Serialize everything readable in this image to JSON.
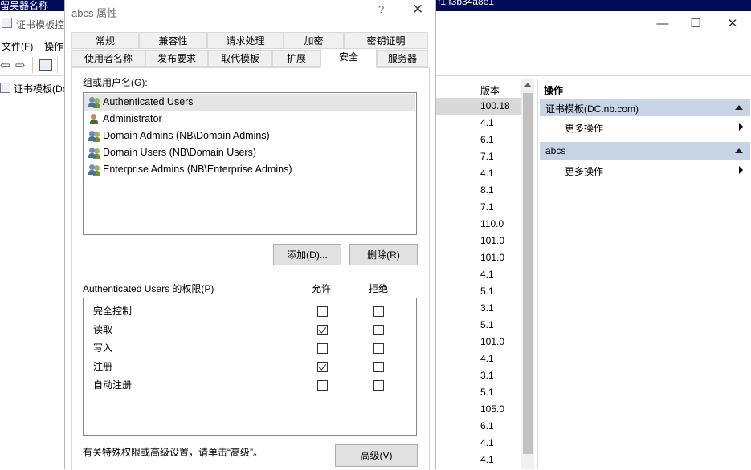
{
  "background_window": {
    "top_strip_left": "留吴器名称",
    "top_strip_right": "f1 f3b34a8e1",
    "title": "证书模板控",
    "menu": [
      "文件(F)",
      "操作"
    ],
    "tree_node": "证书模板(Dc",
    "version_header": "版本",
    "versions": [
      "100.18",
      "4.1",
      "6.1",
      "7.1",
      "4.1",
      "8.1",
      "7.1",
      "110.0",
      "101.0",
      "101.0",
      "4.1",
      "5.1",
      "3.1",
      "5.1",
      "101.0",
      "4.1",
      "3.1",
      "5.1",
      "105.0",
      "6.1",
      "4.1",
      "4.1"
    ],
    "actions_header": "操作",
    "action_groups": [
      {
        "title": "证书模板(DC.nb.com)",
        "item": "更多操作"
      },
      {
        "title": "abcs",
        "item": "更多操作"
      }
    ],
    "win_controls": {
      "minimize": "—",
      "maximize": "☐",
      "close": "✕"
    }
  },
  "dialog": {
    "title": "abcs 属性",
    "help": "?",
    "close": "✕",
    "tabs_row1": [
      "常规",
      "兼容性",
      "请求处理",
      "加密",
      "密钥证明"
    ],
    "tabs_row2": [
      "使用者名称",
      "发布要求",
      "取代模板",
      "扩展",
      "安全",
      "服务器"
    ],
    "active_tab": "安全",
    "group_label": "组或用户名(G):",
    "users": [
      {
        "name": "Authenticated Users",
        "icon": "group-users-icon",
        "selected": true
      },
      {
        "name": "Administrator",
        "icon": "user-icon",
        "selected": false
      },
      {
        "name": "Domain Admins (NB\\Domain Admins)",
        "icon": "group-users-icon",
        "selected": false
      },
      {
        "name": "Domain Users (NB\\Domain Users)",
        "icon": "group-users-icon",
        "selected": false
      },
      {
        "name": "Enterprise Admins (NB\\Enterprise Admins)",
        "icon": "group-users-icon",
        "selected": false
      }
    ],
    "add_button": "添加(D)...",
    "remove_button": "删除(R)",
    "perm_title": "Authenticated Users 的权限(P)",
    "allow_header": "允许",
    "deny_header": "拒绝",
    "permissions": [
      {
        "name": "完全控制",
        "allow": false,
        "deny": false
      },
      {
        "name": "读取",
        "allow": true,
        "deny": false
      },
      {
        "name": "写入",
        "allow": false,
        "deny": false
      },
      {
        "name": "注册",
        "allow": true,
        "deny": false
      },
      {
        "name": "自动注册",
        "allow": false,
        "deny": false
      }
    ],
    "advanced_text": "有关特殊权限或高级设置，请单击“高级”。",
    "advanced_button": "高级(V)"
  }
}
